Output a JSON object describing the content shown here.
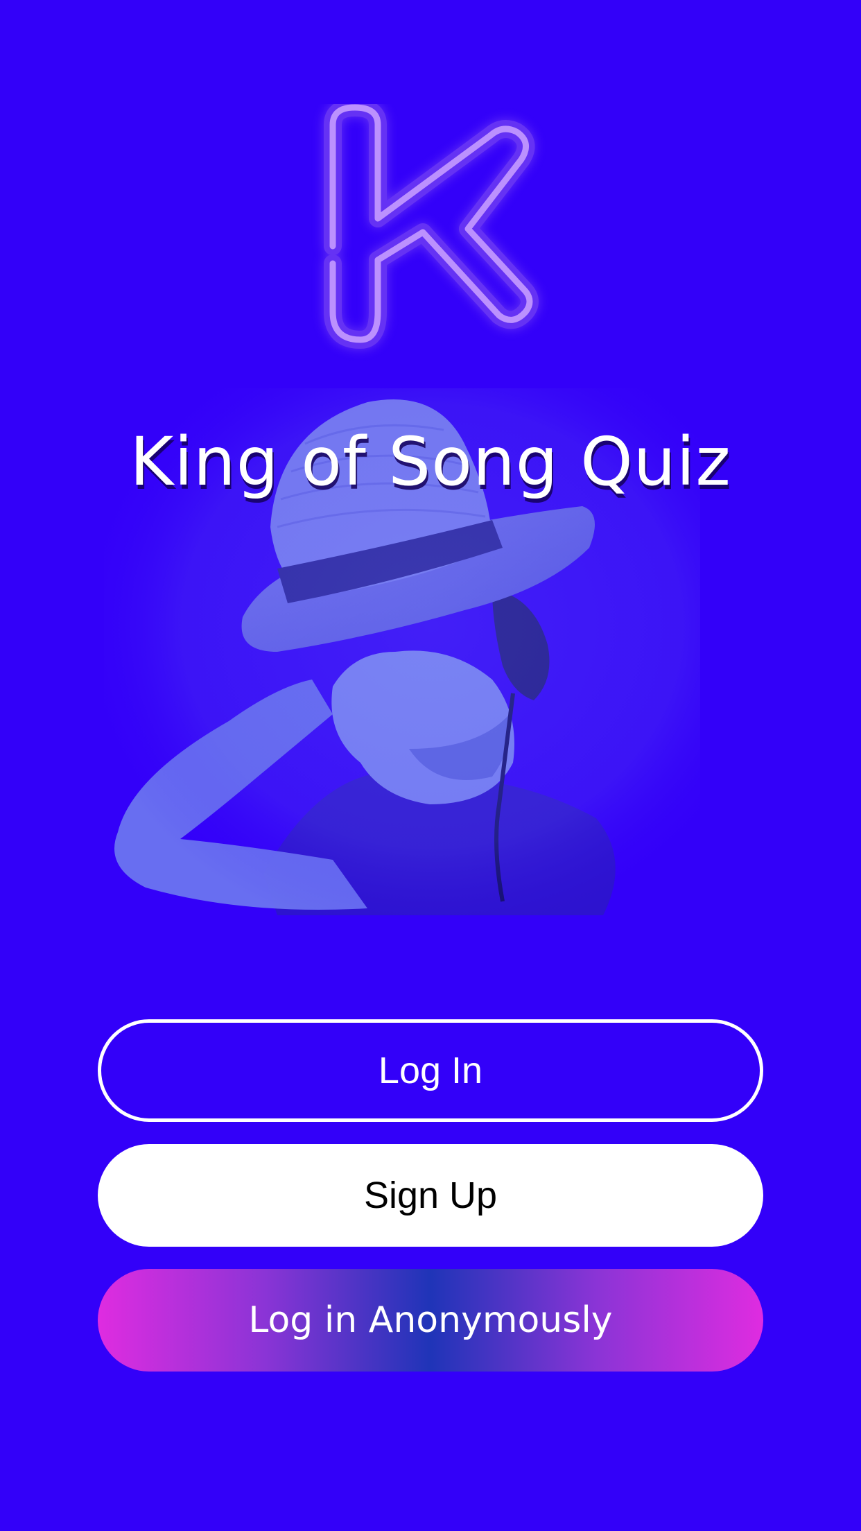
{
  "app": {
    "title": "King of Song Quiz",
    "logo_icon": "neon-k-logo-icon",
    "hero_image": "man-with-hat-and-headphones"
  },
  "buttons": {
    "login_label": "Log In",
    "signup_label": "Sign Up",
    "anonymous_label": "Log in Anonymously"
  },
  "colors": {
    "background": "#3300f9",
    "logo_neon": "#a27ae9",
    "anonymous_gradient_edge": "#df2ce0",
    "anonymous_gradient_center": "#1f34b8"
  }
}
